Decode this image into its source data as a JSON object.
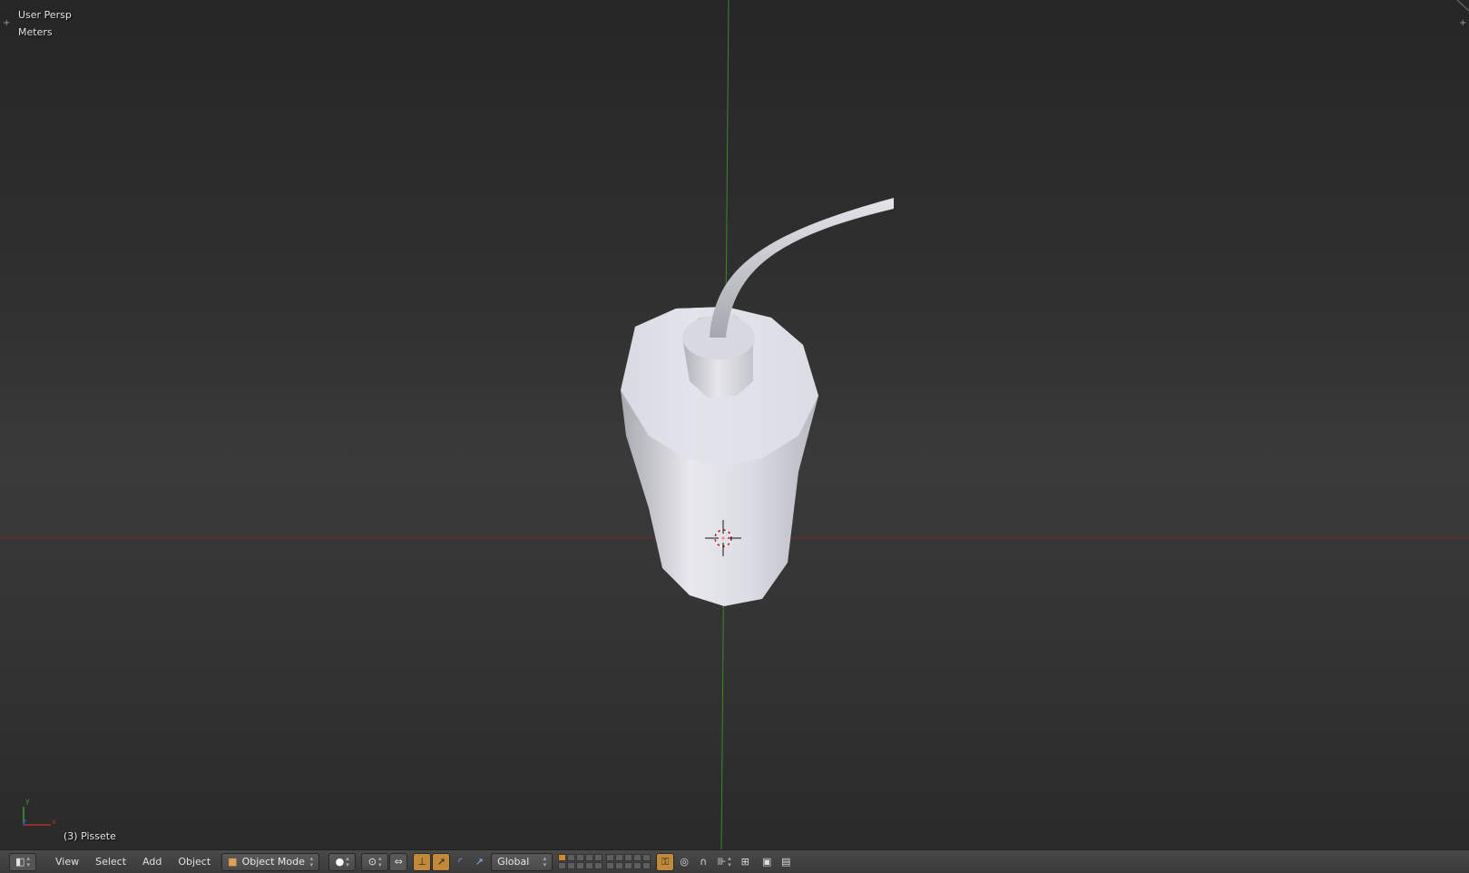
{
  "viewport": {
    "view_label": "User Persp",
    "units_label": "Meters",
    "active_object": "(3) Pissete",
    "background_color": "#393939",
    "x_axis_color": "#7a2a2a",
    "y_axis_color": "#3a8a2a",
    "object_color": "#d6d6dc"
  },
  "header": {
    "menus": [
      "View",
      "Select",
      "Add",
      "Object"
    ],
    "mode": "Object Mode",
    "transform_orientation": "Global",
    "accent_color": "#c08a3a"
  },
  "icons": {
    "editor_type": "3d-view-icon",
    "mode": "cube-icon",
    "shading": "solid-sphere-icon",
    "pivot": "pivot-icon",
    "manipulator": "manipulator-icon",
    "translate": "translate-icon",
    "rotate": "rotate-icon",
    "scale": "scale-icon",
    "lock_layers": "lock-icon",
    "proportional": "proportional-edit-icon",
    "snap": "magnet-icon",
    "snap_element": "snap-increment-icon",
    "render": "render-icon",
    "render_anim": "clapperboard-icon"
  }
}
